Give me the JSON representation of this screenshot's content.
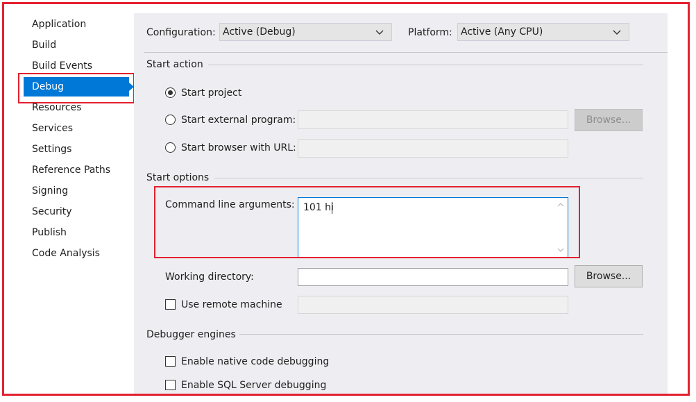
{
  "sidebar": {
    "items": [
      {
        "label": "Application",
        "selected": false
      },
      {
        "label": "Build",
        "selected": false
      },
      {
        "label": "Build Events",
        "selected": false
      },
      {
        "label": "Debug",
        "selected": true
      },
      {
        "label": "Resources",
        "selected": false
      },
      {
        "label": "Services",
        "selected": false
      },
      {
        "label": "Settings",
        "selected": false
      },
      {
        "label": "Reference Paths",
        "selected": false
      },
      {
        "label": "Signing",
        "selected": false
      },
      {
        "label": "Security",
        "selected": false
      },
      {
        "label": "Publish",
        "selected": false
      },
      {
        "label": "Code Analysis",
        "selected": false
      }
    ]
  },
  "config": {
    "configuration_label": "Configuration:",
    "configuration_value": "Active (Debug)",
    "platform_label": "Platform:",
    "platform_value": "Active (Any CPU)"
  },
  "start_action": {
    "title": "Start action",
    "start_project": "Start project",
    "external_program": "Start external program:",
    "browser_url": "Start browser with URL:",
    "browse": "Browse...",
    "selected": "Start project"
  },
  "start_options": {
    "title": "Start options",
    "cmd_args_label": "Command line arguments:",
    "cmd_args_value": "101 hi",
    "working_dir_label": "Working directory:",
    "working_dir_value": "",
    "browse": "Browse...",
    "remote_machine_label": "Use remote machine",
    "remote_machine_checked": false
  },
  "debugger_engines": {
    "title": "Debugger engines",
    "native_label": "Enable native code debugging",
    "native_checked": false,
    "sql_label": "Enable SQL Server debugging",
    "sql_checked": false
  },
  "colors": {
    "accent": "#0078d7",
    "highlight_annotation": "#e3202e",
    "panel_background": "#eeeef2"
  }
}
